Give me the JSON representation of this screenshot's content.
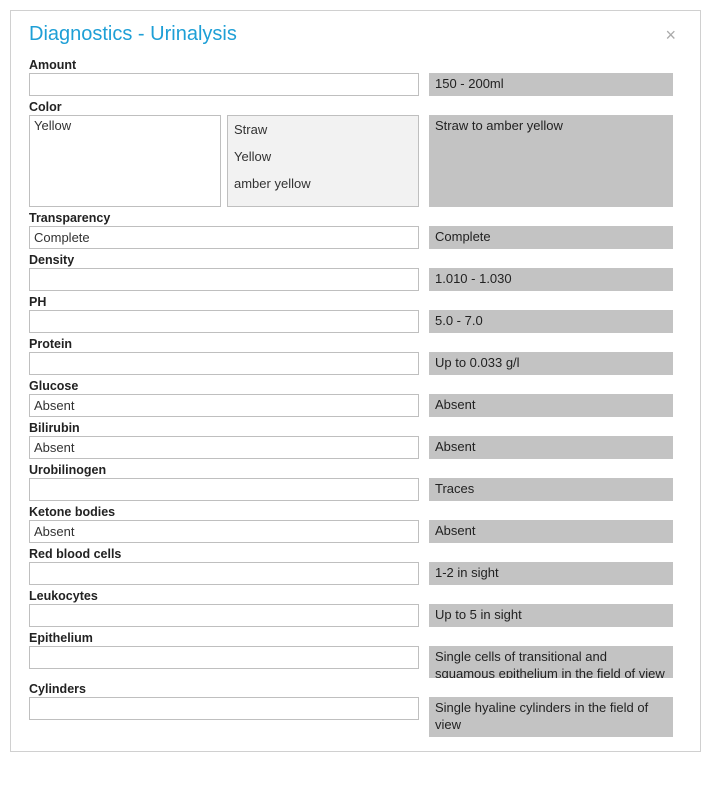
{
  "title": "Diagnostics - Urinalysis",
  "fields": {
    "amount": {
      "label": "Amount",
      "value": "",
      "ref": "150 - 200ml"
    },
    "color": {
      "label": "Color",
      "value": "Yellow",
      "options": [
        "Straw",
        "Yellow",
        "amber yellow"
      ],
      "ref": "Straw to amber yellow"
    },
    "transparency": {
      "label": "Transparency",
      "value": "Complete",
      "ref": "Complete"
    },
    "density": {
      "label": "Density",
      "value": "",
      "ref": "1.010 - 1.030"
    },
    "ph": {
      "label": "PH",
      "value": "",
      "ref": "5.0 - 7.0"
    },
    "protein": {
      "label": "Protein",
      "value": "",
      "ref": "Up to 0.033 g/l"
    },
    "glucose": {
      "label": "Glucose",
      "value": "Absent",
      "ref": "Absent"
    },
    "bilirubin": {
      "label": "Bilirubin",
      "value": "Absent",
      "ref": "Absent"
    },
    "urobilinogen": {
      "label": "Urobilinogen",
      "value": "",
      "ref": "Traces"
    },
    "ketone": {
      "label": "Ketone bodies",
      "value": "Absent",
      "ref": "Absent"
    },
    "rbc": {
      "label": "Red blood cells",
      "value": "",
      "ref": "1-2 in sight"
    },
    "leukocytes": {
      "label": "Leukocytes",
      "value": "",
      "ref": "Up to 5 in sight"
    },
    "epithelium": {
      "label": "Epithelium",
      "value": "",
      "ref": "Single cells of transitional and squamous epithelium in the field of view"
    },
    "cylinders": {
      "label": "Cylinders",
      "value": "",
      "ref": "Single hyaline cylinders in the field of view"
    }
  }
}
